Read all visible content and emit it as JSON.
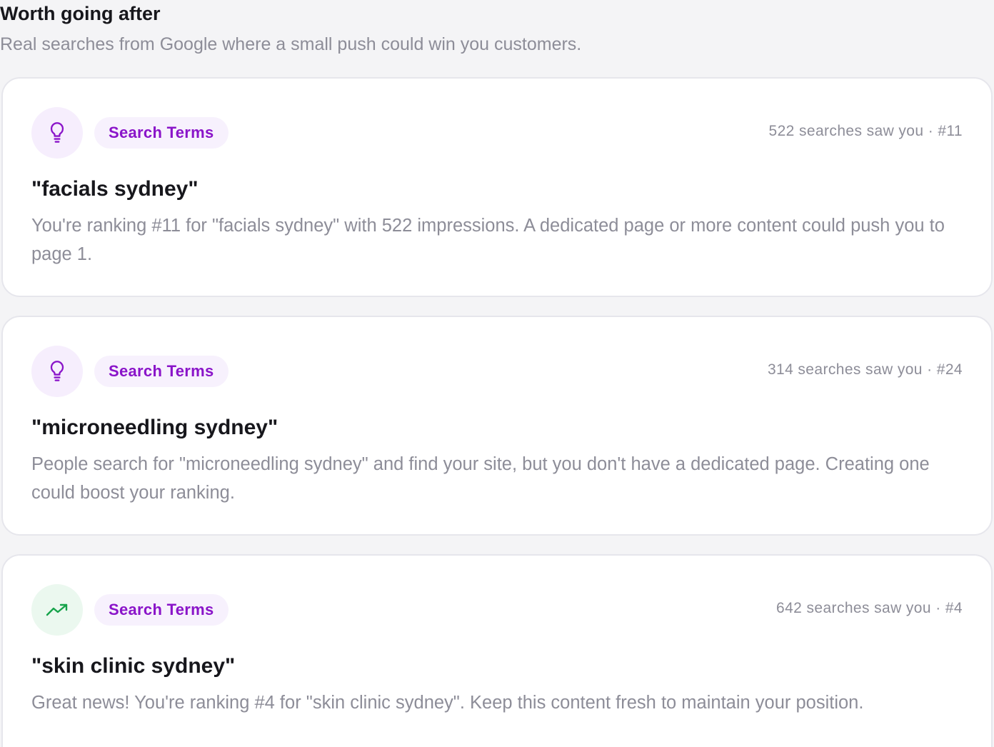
{
  "header": {
    "title": "Worth going after",
    "subtitle": "Real searches from Google where a small push could win you customers."
  },
  "colors": {
    "badge_text": "#8a14c9",
    "badge_bg": "#f7f1fd",
    "icon_purple": "#8a14c9",
    "icon_green": "#16a34a"
  },
  "cards": [
    {
      "icon": "lightbulb-icon",
      "badge": "Search Terms",
      "meta": "522 searches saw you · #11",
      "title": "\"facials sydney\"",
      "description": "You're ranking #11 for \"facials sydney\" with 522 impressions. A dedicated page or more content could push you to page 1."
    },
    {
      "icon": "lightbulb-icon",
      "badge": "Search Terms",
      "meta": "314 searches saw you · #24",
      "title": "\"microneedling sydney\"",
      "description": "People search for \"microneedling sydney\" and find your site, but you don't have a dedicated page. Creating one could boost your ranking."
    },
    {
      "icon": "trending-up-icon",
      "badge": "Search Terms",
      "meta": "642 searches saw you · #4",
      "title": "\"skin clinic sydney\"",
      "description": "Great news! You're ranking #4 for \"skin clinic sydney\". Keep this content fresh to maintain your position."
    }
  ]
}
